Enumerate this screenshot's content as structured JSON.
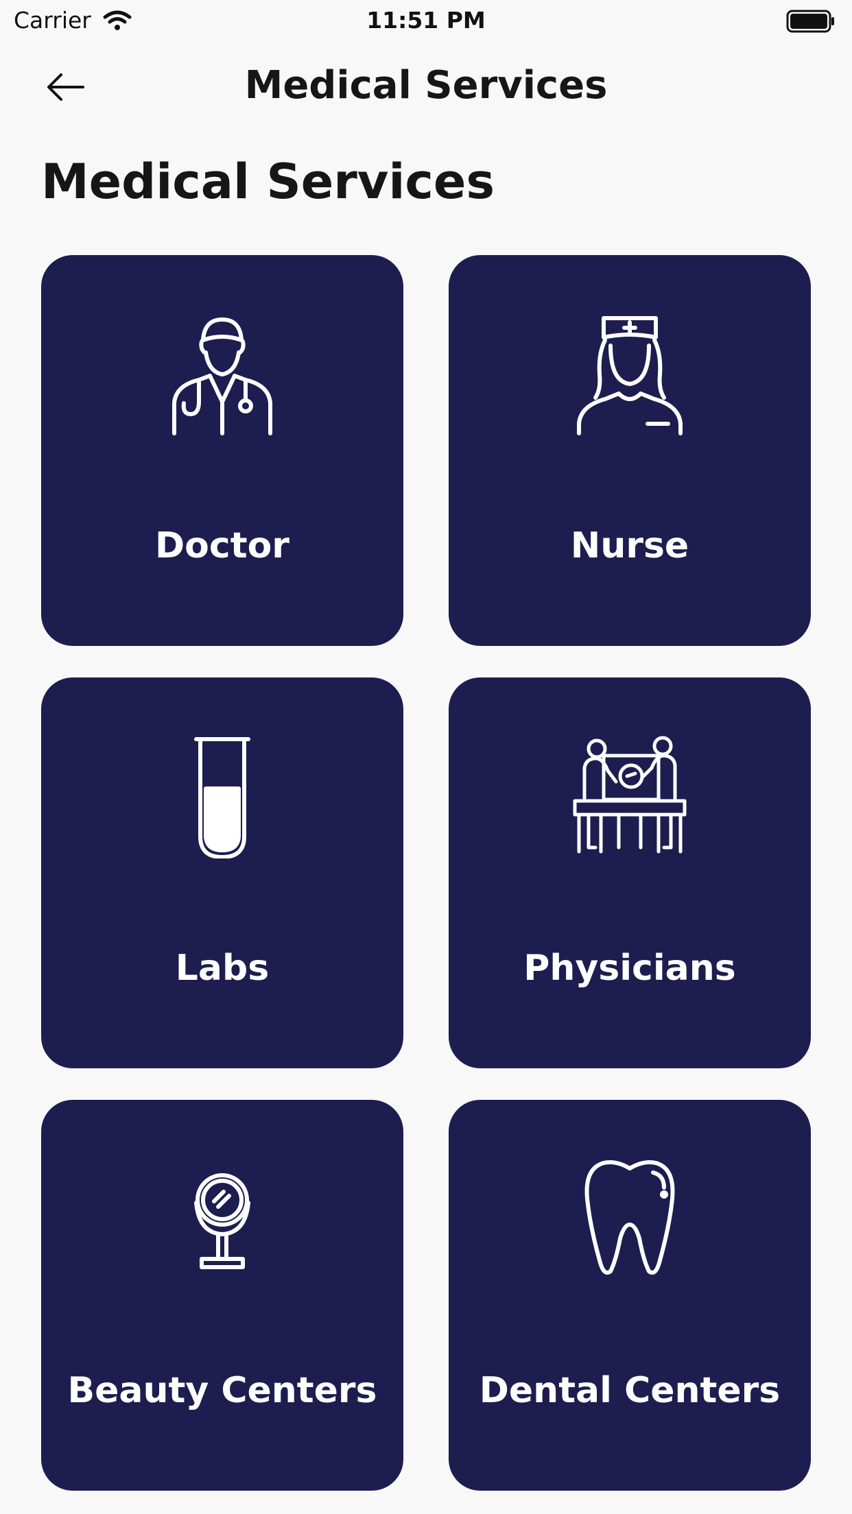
{
  "status_bar": {
    "carrier": "Carrier",
    "time": "11:51 PM",
    "wifi_icon": "wifi-icon",
    "battery_icon": "battery-icon"
  },
  "nav": {
    "back_icon": "arrow-left-icon",
    "title": "Medical Services"
  },
  "page": {
    "heading": "Medical Services"
  },
  "colors": {
    "background": "#f8f8f8",
    "card": "#1d1d50",
    "card_text": "#ffffff",
    "text": "#161616"
  },
  "services": [
    {
      "label": "Doctor",
      "icon": "doctor-icon"
    },
    {
      "label": "Nurse",
      "icon": "nurse-icon"
    },
    {
      "label": "Labs",
      "icon": "test-tube-icon"
    },
    {
      "label": "Physicians",
      "icon": "consultation-icon"
    },
    {
      "label": "Beauty Centers",
      "icon": "mirror-icon"
    },
    {
      "label": "Dental Centers",
      "icon": "tooth-icon"
    }
  ]
}
